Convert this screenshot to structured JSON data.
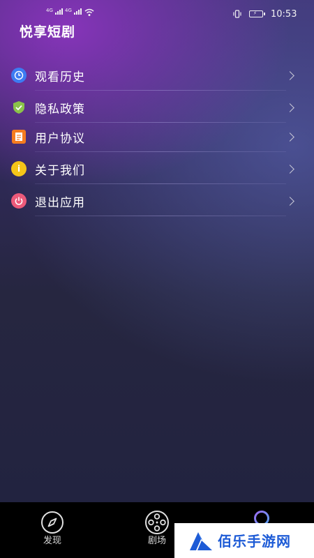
{
  "status_bar": {
    "network_1": "4G",
    "network_2": "4G",
    "time": "10:53"
  },
  "header": {
    "app_title": "悦享短剧"
  },
  "menu": {
    "items": [
      {
        "label": "观看历史",
        "icon": "clock-icon",
        "color": "#3d7cf2"
      },
      {
        "label": "隐私政策",
        "icon": "shield-check-icon",
        "color": "#8bc34a"
      },
      {
        "label": "用户协议",
        "icon": "document-icon",
        "color": "#f57c1f"
      },
      {
        "label": "关于我们",
        "icon": "info-icon",
        "color": "#f5c518"
      },
      {
        "label": "退出应用",
        "icon": "power-icon",
        "color": "#ec5a7a"
      }
    ]
  },
  "tab_bar": {
    "tabs": [
      {
        "label": "发现",
        "icon": "compass-icon"
      },
      {
        "label": "剧场",
        "icon": "film-reel-icon"
      },
      {
        "label": "",
        "icon": "profile-ring-icon"
      }
    ]
  },
  "watermark": {
    "text": "佰乐手游网"
  }
}
